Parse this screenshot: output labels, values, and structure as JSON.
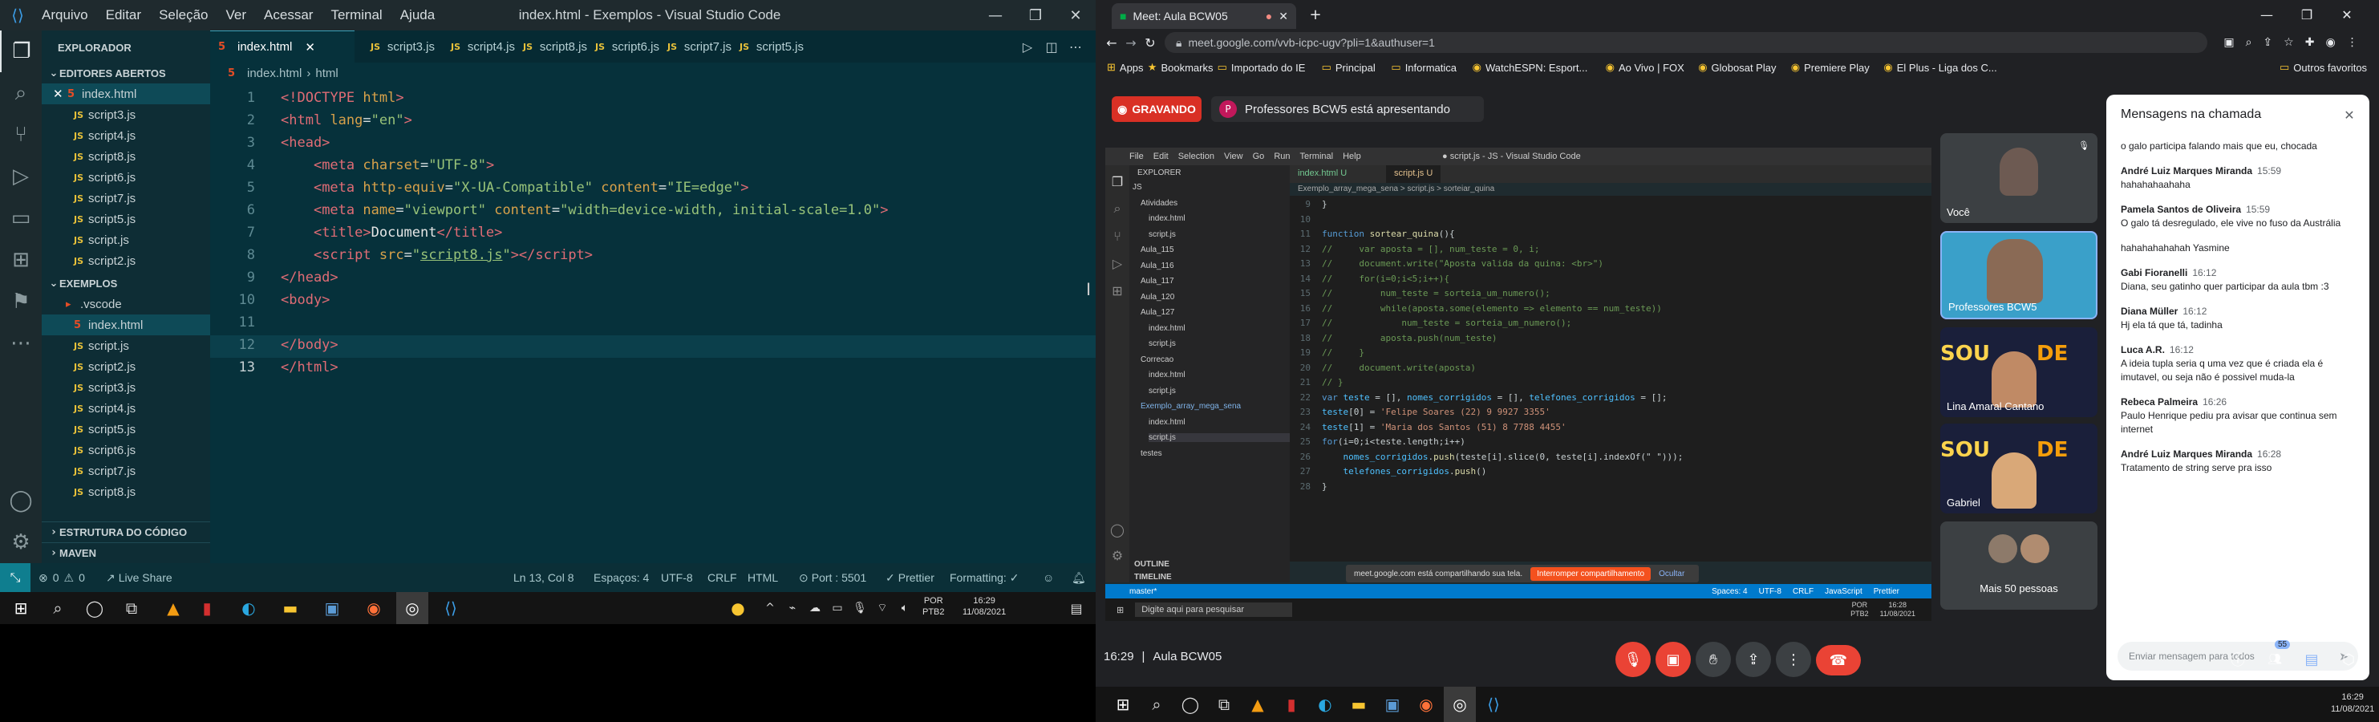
{
  "vscode": {
    "menu": [
      "Arquivo",
      "Editar",
      "Seleção",
      "Ver",
      "Acessar",
      "Terminal",
      "Ajuda"
    ],
    "window_title": "index.html - Exemplos - Visual Studio Code",
    "explorer_title": "EXPLORADOR",
    "open_editors_title": "EDITORES ABERTOS",
    "open_editors": [
      "index.html",
      "script3.js",
      "script4.js",
      "script8.js",
      "script6.js",
      "script7.js",
      "script5.js",
      "script.js",
      "script2.js"
    ],
    "folder_title": "EXEMPLOS",
    "folder_items": [
      ".vscode",
      "index.html",
      "script.js",
      "script2.js",
      "script3.js",
      "script4.js",
      "script5.js",
      "script6.js",
      "script7.js",
      "script8.js"
    ],
    "outline_title": "ESTRUTURA DO CÓDIGO",
    "maven_title": "MAVEN",
    "tabs": [
      "index.html",
      "script3.js",
      "script4.js",
      "script8.js",
      "script6.js",
      "script7.js",
      "script5.js"
    ],
    "breadcrumb": [
      "index.html",
      "html"
    ],
    "code": [
      {
        "n": "1",
        "html": "<span class='kw'>&lt;!DOCTYPE</span> <span class='at'>html</span><span class='kw'>&gt;</span>"
      },
      {
        "n": "2",
        "html": "<span class='kw'>&lt;html</span> <span class='at'>lang</span>=<span class='st'>\"en\"</span><span class='kw'>&gt;</span>"
      },
      {
        "n": "3",
        "html": "<span class='kw'>&lt;head&gt;</span>"
      },
      {
        "n": "4",
        "html": "    <span class='kw'>&lt;meta</span> <span class='at'>charset</span>=<span class='st'>\"UTF-8\"</span><span class='kw'>&gt;</span>"
      },
      {
        "n": "5",
        "html": "    <span class='kw'>&lt;meta</span> <span class='at'>http-equiv</span>=<span class='st'>\"X-UA-Compatible\"</span> <span class='at'>content</span>=<span class='st'>\"IE=edge\"</span><span class='kw'>&gt;</span>"
      },
      {
        "n": "6",
        "html": "    <span class='kw'>&lt;meta</span> <span class='at'>name</span>=<span class='st'>\"viewport\"</span> <span class='at'>content</span>=<span class='st'>\"width=device-width, initial-scale=1.0\"</span><span class='kw'>&gt;</span>"
      },
      {
        "n": "7",
        "html": "    <span class='kw'>&lt;title&gt;</span><span class='tx'>Document</span><span class='kw'>&lt;/title&gt;</span>"
      },
      {
        "n": "8",
        "html": "    <span class='kw'>&lt;script</span> <span class='at'>src</span>=<span class='st'>\"<u>script8.js</u>\"</span><span class='kw'>&gt;&lt;/script&gt;</span>"
      },
      {
        "n": "9",
        "html": "<span class='kw'>&lt;/head&gt;</span>"
      },
      {
        "n": "10",
        "html": "<span class='kw'>&lt;body&gt;</span>"
      },
      {
        "n": "11",
        "html": ""
      },
      {
        "n": "12",
        "html": "<span class='kw'>&lt;/body&gt;</span>"
      },
      {
        "n": "13",
        "html": "<span class='kw'>&lt;/html&gt;</span>"
      }
    ],
    "status": {
      "errors": "0",
      "warnings": "0",
      "liveshare": "Live Share",
      "position": "Ln 13, Col 8",
      "spaces": "Espaços: 4",
      "encoding": "UTF-8",
      "eol": "CRLF",
      "lang": "HTML",
      "port": "Port : 5501",
      "prettier": "Prettier",
      "formatting": "Formatting: ✓"
    }
  },
  "left_taskbar": {
    "lang": "POR",
    "layout": "PTB2",
    "time": "16:29",
    "date": "11/08/2021"
  },
  "chrome": {
    "tab_title": "Meet: Aula BCW05",
    "url": "meet.google.com/vvb-icpc-ugv?pli=1&authuser=1",
    "bookmarks": [
      "Apps",
      "Bookmarks",
      "Importado do IE",
      "Principal",
      "Informatica",
      "WatchESPN: Esport...",
      "Ao Vivo | FOX",
      "Globosat Play",
      "Premiere Play",
      "El Plus - Liga dos C..."
    ],
    "other_bookmarks": "Outros favoritos"
  },
  "meet": {
    "recording": "GRAVANDO",
    "presenter_initial": "P",
    "presenting": "Professores BCW5 está apresentando",
    "meeting_time": "16:29",
    "meeting_name": "Aula BCW05",
    "participants_count": "55",
    "tiles": [
      {
        "name": "Você"
      },
      {
        "name": "Professores BCW5"
      },
      {
        "name": "Lina Amaral Cantano"
      },
      {
        "name": "Gabriel"
      },
      {
        "name": "Mais 50 pessoas"
      }
    ],
    "chat_title": "Mensagens na chamada",
    "chat_input_placeholder": "Enviar mensagem para todos",
    "chat": [
      {
        "name": "",
        "time": "",
        "text": "o galo participa falando mais que eu, chocada"
      },
      {
        "name": "André Luiz Marques Miranda",
        "time": "15:59",
        "text": "hahahahaahaha"
      },
      {
        "name": "Pamela Santos de Oliveira",
        "time": "15:59",
        "text": "O galo tá desregulado, ele vive no fuso da Austrália"
      },
      {
        "name": "",
        "time": "",
        "text": "hahahahahahah Yasmine"
      },
      {
        "name": "Gabi Fioranelli",
        "time": "16:12",
        "text": "Diana, seu gatinho quer participar da aula tbm :3"
      },
      {
        "name": "Diana Müller",
        "time": "16:12",
        "text": "Hj ela tá que tá, tadinha"
      },
      {
        "name": "Luca A.R.",
        "time": "16:12",
        "text": "A ideia tupla seria q uma vez que é criada ela é imutavel, ou seja não é possivel muda-la"
      },
      {
        "name": "Rebeca Palmeira",
        "time": "16:26",
        "text": "Paulo Henrique pediu pra avisar que continua sem internet"
      },
      {
        "name": "André Luiz Marques Miranda",
        "time": "16:28",
        "text": "Tratamento de string serve pra isso"
      }
    ],
    "shared": {
      "menu": [
        "File",
        "Edit",
        "Selection",
        "View",
        "Go",
        "Run",
        "Terminal",
        "Help"
      ],
      "title": "● script.js - JS - Visual Studio Code",
      "explorer": "EXPLORER",
      "tabs": [
        "index.html U",
        "script.js U"
      ],
      "breadcrumb": "Exemplo_array_mega_sena > script.js > sorteiar_quina",
      "tree": [
        "JS",
        "Atividades",
        "index.html",
        "script.js",
        "Aula_115",
        "Aula_116",
        "Aula_117",
        "Aula_120",
        "Aula_127",
        "index.html",
        "script.js",
        "Correcao",
        "index.html",
        "script.js",
        "Exemplo_array_mega_sena",
        "index.html",
        "script.js",
        "testes"
      ],
      "outline": "OUTLINE",
      "timeline": "TIMELINE",
      "code": [
        {
          "n": "9",
          "html": "}"
        },
        {
          "n": "10",
          "html": ""
        },
        {
          "n": "11",
          "html": "<span class='kwi'>function</span> <span class='fn'>sortear_quina</span>(){"
        },
        {
          "n": "12",
          "html": "<span class='cmt'>//     var aposta = [], num_teste = 0, i;</span>"
        },
        {
          "n": "13",
          "html": "<span class='cmt'>//     document.write(\"Aposta valida da quina: &lt;br&gt;\")</span>"
        },
        {
          "n": "14",
          "html": "<span class='cmt'>//     for(i=0;i&lt;5;i++){</span>"
        },
        {
          "n": "15",
          "html": "<span class='cmt'>//         num_teste = sorteia_um_numero();</span>"
        },
        {
          "n": "16",
          "html": "<span class='cmt'>//         while(aposta.some(elemento =&gt; elemento == num_teste))</span>"
        },
        {
          "n": "17",
          "html": "<span class='cmt'>//             num_teste = sorteia_um_numero();</span>"
        },
        {
          "n": "18",
          "html": "<span class='cmt'>//         aposta.push(num_teste)</span>"
        },
        {
          "n": "19",
          "html": "<span class='cmt'>//     }</span>"
        },
        {
          "n": "20",
          "html": "<span class='cmt'>//     document.write(aposta)</span>"
        },
        {
          "n": "21",
          "html": "<span class='cmt'>// }</span>"
        },
        {
          "n": "22",
          "html": "<span class='kwi'>var</span> <span class='var'>teste</span> = [], <span class='var'>nomes_corrigidos</span> = [], <span class='var'>telefones_corrigidos</span> = [];"
        },
        {
          "n": "23",
          "html": "<span class='var'>teste</span>[0] = <span class='str'>'Felipe Soares (22) 9 9927 3355'</span>"
        },
        {
          "n": "24",
          "html": "<span class='var'>teste</span>[1] = <span class='str'>'Maria dos Santos (51) 8 7788 4455'</span>"
        },
        {
          "n": "25",
          "html": "<span class='kwi'>for</span>(i=0;i&lt;teste.length;i++)"
        },
        {
          "n": "26",
          "html": "    <span class='var'>nomes_corrigidos</span>.<span class='fn'>push</span>(teste[i].slice(0, teste[i].indexOf(\" \")));"
        },
        {
          "n": "27",
          "html": "    <span class='var'>telefones_corrigidos</span>.<span class='fn'>push</span>()"
        },
        {
          "n": "28",
          "html": "}"
        }
      ],
      "share_notice": "meet.google.com está compartilhando sua tela.",
      "stop_share": "Interromper compartilhamento",
      "hide": "Ocultar",
      "status_left": "master*",
      "status_right": [
        "Spaces: 4",
        "UTF-8",
        "CRLF",
        "JavaScript",
        "Prettier"
      ],
      "search_placeholder": "Digite aqui para pesquisar",
      "tb_time": "16:28",
      "tb_date": "11/08/2021",
      "tb_lang": "POR",
      "tb_layout": "PTB2"
    }
  },
  "right_taskbar": {
    "time": "16:29",
    "date": "11/08/2021"
  },
  "colors": {
    "accent_red": "#d93025",
    "vscode_bg": "#06313b",
    "meet_bg": "#202124"
  }
}
